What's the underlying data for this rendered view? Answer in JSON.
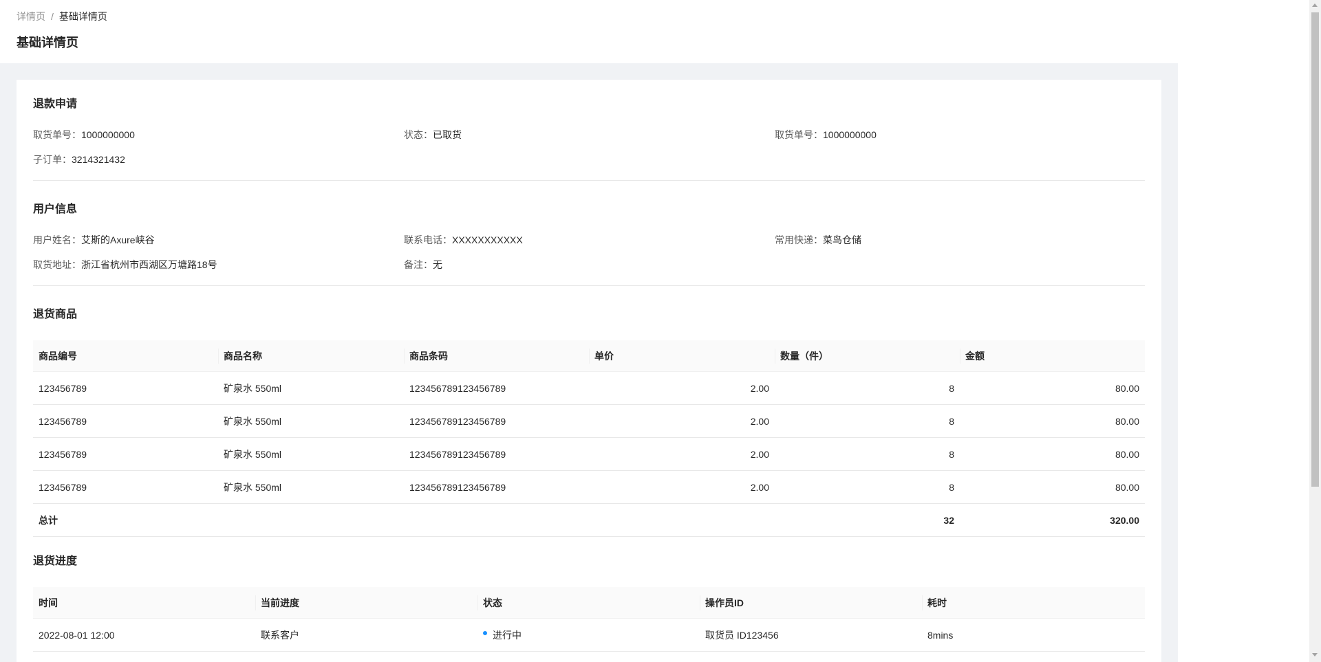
{
  "breadcrumb": {
    "parent": "详情页",
    "separator": "/",
    "current": "基础详情页"
  },
  "page_title": "基础详情页",
  "refund": {
    "title": "退款申请",
    "items": [
      {
        "label": "取货单号：",
        "value": "1000000000"
      },
      {
        "label": "状态：",
        "value": "已取货"
      },
      {
        "label": "取货单号：",
        "value": "1000000000"
      },
      {
        "label": "子订单：",
        "value": "3214321432"
      }
    ]
  },
  "user": {
    "title": "用户信息",
    "items": [
      {
        "label": "用户姓名：",
        "value": "艾斯的Axure峡谷"
      },
      {
        "label": "联系电话：",
        "value": "XXXXXXXXXXX"
      },
      {
        "label": "常用快递：",
        "value": "菜鸟仓储"
      },
      {
        "label": "取货地址：",
        "value": "浙江省杭州市西湖区万塘路18号"
      },
      {
        "label": "备注：",
        "value": "无"
      }
    ]
  },
  "goods": {
    "title": "退货商品",
    "columns": [
      "商品编号",
      "商品名称",
      "商品条码",
      "单价",
      "数量（件）",
      "金额"
    ],
    "rows": [
      [
        "123456789",
        "矿泉水 550ml",
        "123456789123456789",
        "2.00",
        "8",
        "80.00"
      ],
      [
        "123456789",
        "矿泉水 550ml",
        "123456789123456789",
        "2.00",
        "8",
        "80.00"
      ],
      [
        "123456789",
        "矿泉水 550ml",
        "123456789123456789",
        "2.00",
        "8",
        "80.00"
      ],
      [
        "123456789",
        "矿泉水 550ml",
        "123456789123456789",
        "2.00",
        "8",
        "80.00"
      ]
    ],
    "total": {
      "label": "总计",
      "quantity": "32",
      "amount": "320.00"
    }
  },
  "progress": {
    "title": "退货进度",
    "columns": [
      "时间",
      "当前进度",
      "状态",
      "操作员ID",
      "耗时"
    ],
    "rows": [
      {
        "time": "2022-08-01  12:00",
        "step": "联系客户",
        "status": "进行中",
        "operator": "取货员 ID123456",
        "duration": "8mins"
      }
    ]
  },
  "colors": {
    "page_bg": "#f0f2f5",
    "card_bg": "#ffffff",
    "status_processing": "#1890ff",
    "table_header_bg": "#fafafa"
  }
}
